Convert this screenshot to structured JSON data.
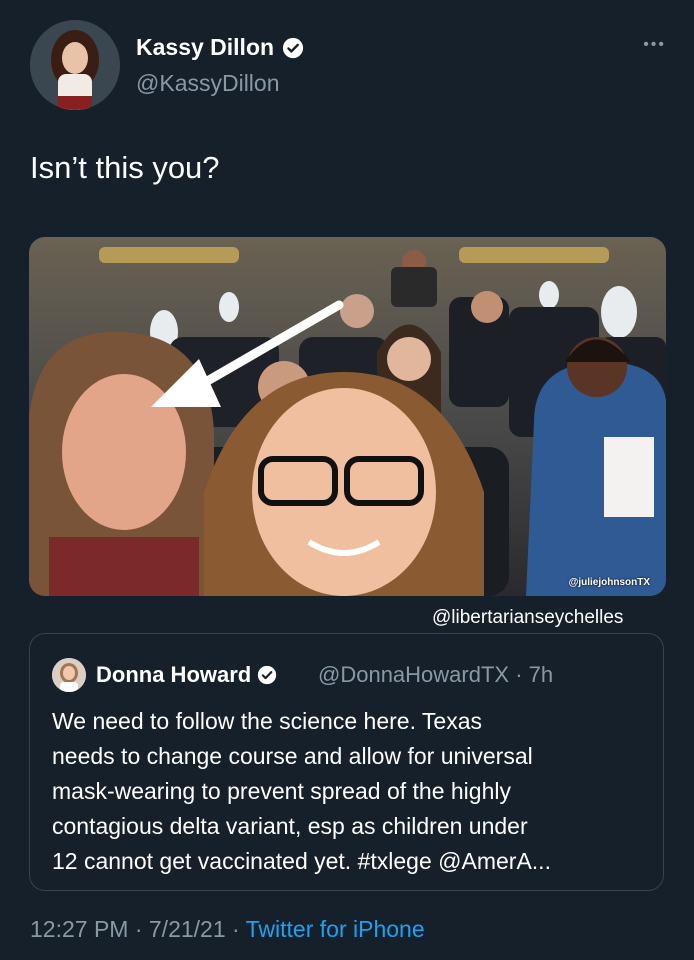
{
  "tweet": {
    "author": {
      "name": "Kassy Dillon",
      "handle": "@KassyDillon"
    },
    "more_label": "•••",
    "text": "Isn’t this you?",
    "media": {
      "image_watermark": "@juliejohnsonTX"
    },
    "page_watermark": "@libertarianseychelles",
    "quoted": {
      "author_name": "Donna Howard",
      "handle_time": "@DonnaHowardTX · 7h",
      "text_lines": [
        "We need to follow the science here. Texas",
        "needs to change course and allow for universal",
        "mask-wearing to prevent spread of the highly",
        "contagious delta variant, esp as children under",
        "12 cannot get vaccinated yet. #txlege @AmerA..."
      ]
    },
    "footer": {
      "time_date": "12:27 PM · 7/21/21 · ",
      "source": "Twitter for iPhone"
    }
  },
  "colors": {
    "background": "#15202b",
    "secondary_text": "#8899a6",
    "link": "#1da1f2",
    "border": "#38444d"
  }
}
